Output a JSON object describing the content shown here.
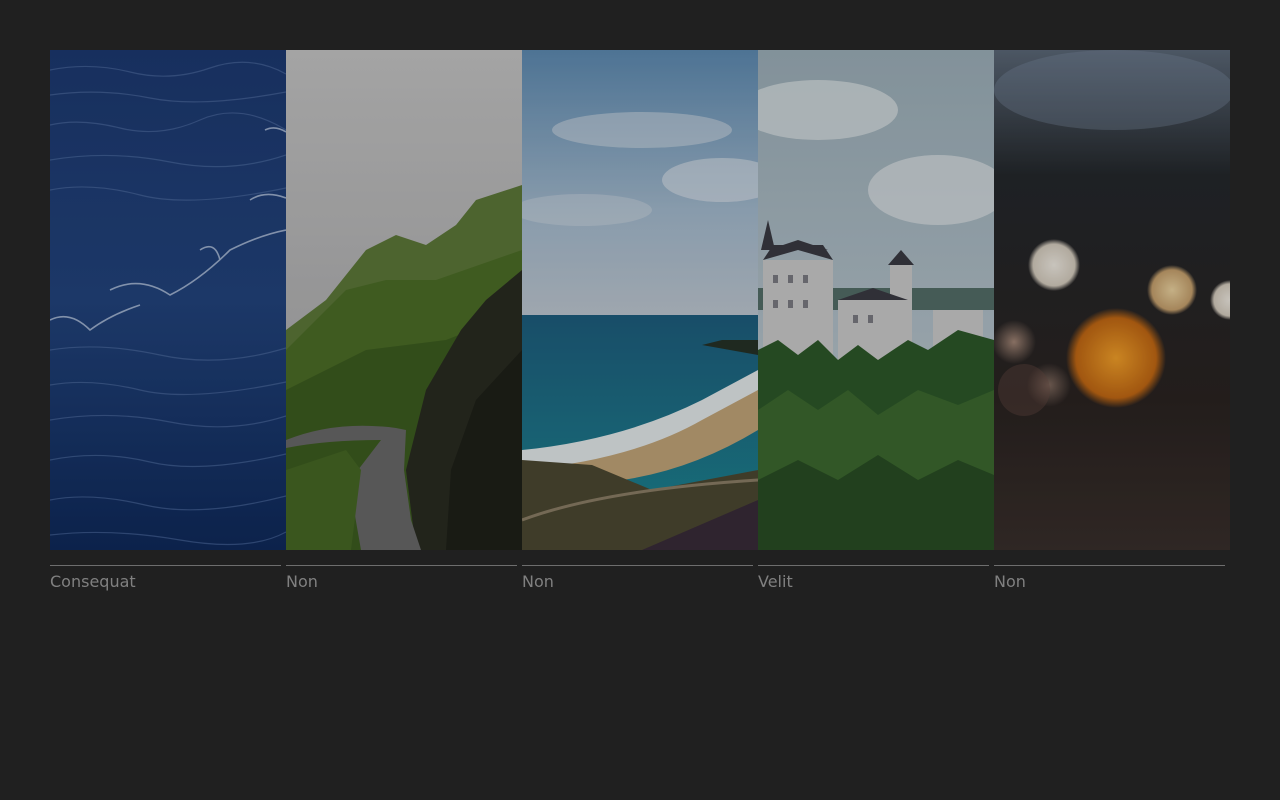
{
  "gallery": {
    "background_color": "#202020",
    "caption_color": "#808080",
    "divider_color": "#6e6e6e",
    "slides": [
      {
        "caption": "Consequat",
        "image": "ocean-waves-photo"
      },
      {
        "caption": "Non",
        "image": "green-mountain-road-photo"
      },
      {
        "caption": "Non",
        "image": "coastal-beach-photo"
      },
      {
        "caption": "Velit",
        "image": "castle-forest-photo"
      },
      {
        "caption": "Non",
        "image": "bokeh-lights-photo"
      }
    ]
  }
}
